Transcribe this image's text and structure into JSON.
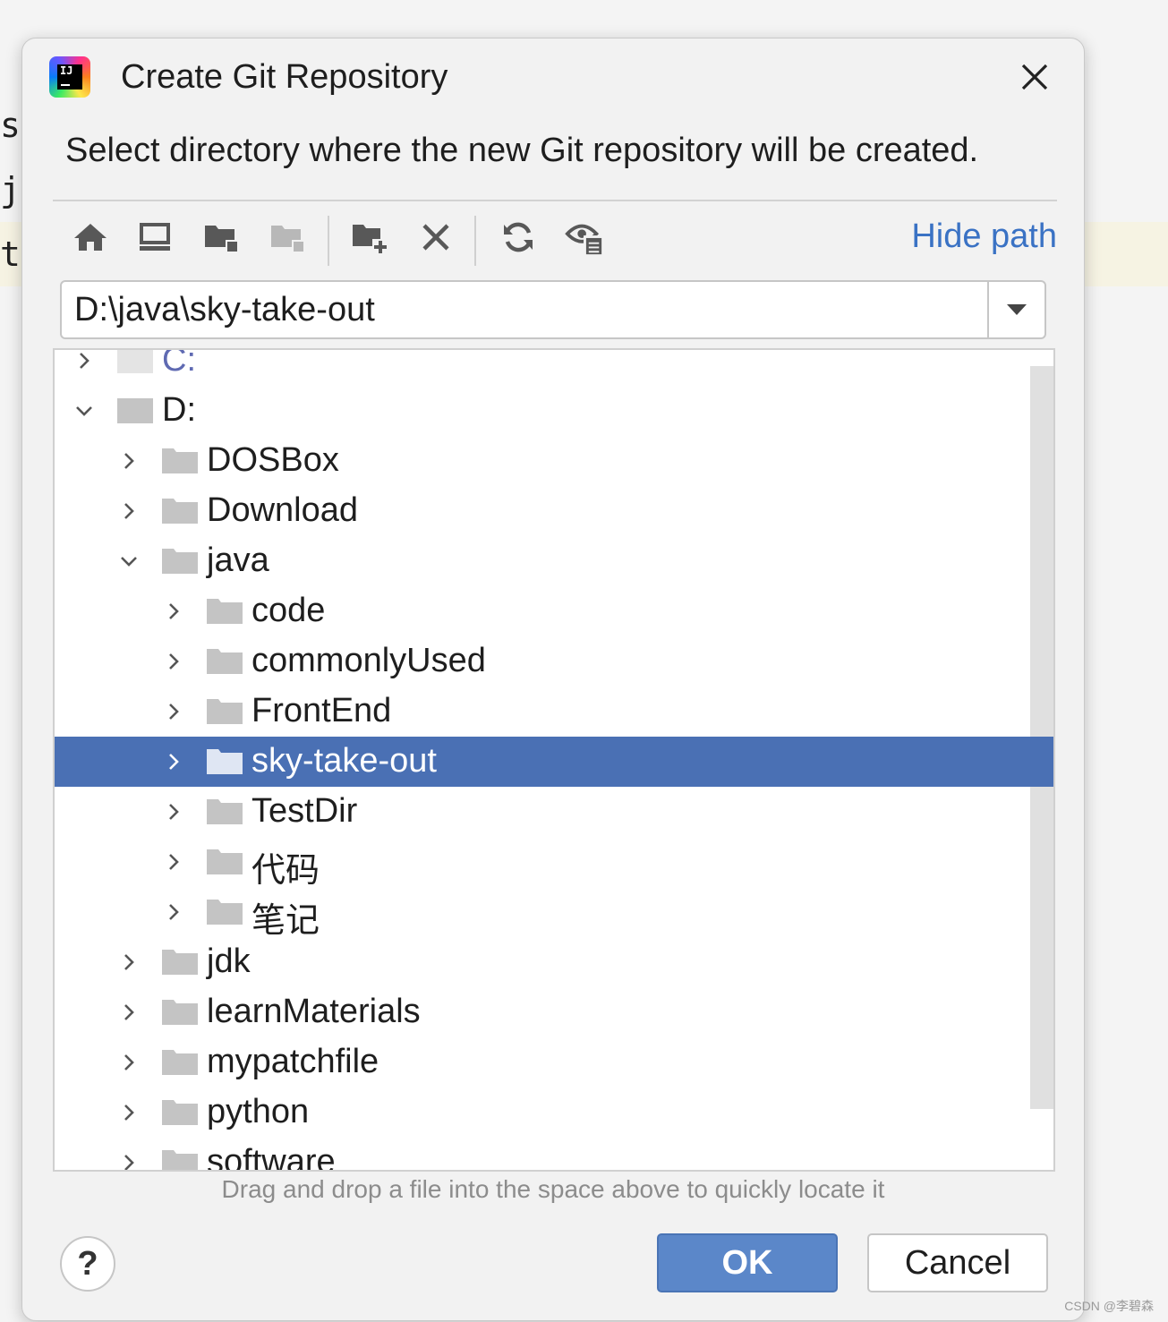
{
  "background": {
    "fragments": [
      "s",
      "j",
      "t"
    ]
  },
  "dialog": {
    "title": "Create Git Repository",
    "description": "Select directory where the new Git repository will be created.",
    "hide_path_label": "Hide path",
    "path_value": "D:\\java\\sky-take-out",
    "toolbar_icons": [
      "home-icon",
      "desktop-icon",
      "project-folder-icon",
      "module-folder-icon",
      "new-folder-icon",
      "delete-icon",
      "refresh-icon",
      "show-hidden-icon"
    ],
    "tree": [
      {
        "label": "C:",
        "level": 0,
        "expanded": false,
        "selected": false
      },
      {
        "label": "D:",
        "level": 0,
        "expanded": true,
        "selected": false
      },
      {
        "label": "DOSBox",
        "level": 1,
        "expanded": false,
        "selected": false
      },
      {
        "label": "Download",
        "level": 1,
        "expanded": false,
        "selected": false
      },
      {
        "label": "java",
        "level": 1,
        "expanded": true,
        "selected": false
      },
      {
        "label": "code",
        "level": 2,
        "expanded": false,
        "selected": false
      },
      {
        "label": "commonlyUsed",
        "level": 2,
        "expanded": false,
        "selected": false
      },
      {
        "label": "FrontEnd",
        "level": 2,
        "expanded": false,
        "selected": false
      },
      {
        "label": "sky-take-out",
        "level": 2,
        "expanded": false,
        "selected": true
      },
      {
        "label": "TestDir",
        "level": 2,
        "expanded": false,
        "selected": false
      },
      {
        "label": "代码",
        "level": 2,
        "expanded": false,
        "selected": false
      },
      {
        "label": "笔记",
        "level": 2,
        "expanded": false,
        "selected": false
      },
      {
        "label": "jdk",
        "level": 1,
        "expanded": false,
        "selected": false
      },
      {
        "label": "learnMaterials",
        "level": 1,
        "expanded": false,
        "selected": false
      },
      {
        "label": "mypatchfile",
        "level": 1,
        "expanded": false,
        "selected": false
      },
      {
        "label": "python",
        "level": 1,
        "expanded": false,
        "selected": false
      },
      {
        "label": "software",
        "level": 1,
        "expanded": false,
        "selected": false
      }
    ],
    "drop_hint": "Drag and drop a file into the space above to quickly locate it",
    "help_label": "?",
    "ok_label": "OK",
    "cancel_label": "Cancel"
  },
  "watermark": "CSDN @李碧森",
  "colors": {
    "selection": "#4a70b4",
    "link": "#3a72c4",
    "ok_button": "#5b87c9",
    "folder": "#c4c4c4"
  }
}
